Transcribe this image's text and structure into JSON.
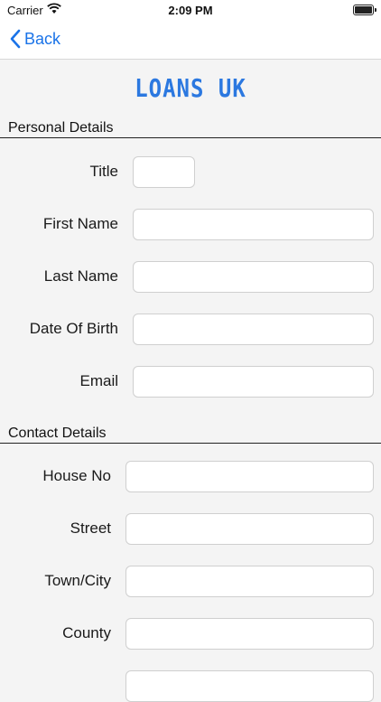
{
  "status_bar": {
    "carrier": "Carrier",
    "time": "2:09 PM"
  },
  "nav": {
    "back_label": "Back"
  },
  "app_title": "LOANS UK",
  "sections": {
    "personal": {
      "title": "Personal Details",
      "fields": {
        "title": {
          "label": "Title",
          "value": ""
        },
        "first_name": {
          "label": "First Name",
          "value": ""
        },
        "last_name": {
          "label": "Last Name",
          "value": ""
        },
        "dob": {
          "label": "Date Of Birth",
          "value": ""
        },
        "email": {
          "label": "Email",
          "value": ""
        }
      }
    },
    "contact": {
      "title": "Contact Details",
      "fields": {
        "house_no": {
          "label": "House No",
          "value": ""
        },
        "street": {
          "label": "Street",
          "value": ""
        },
        "town_city": {
          "label": "Town/City",
          "value": ""
        },
        "county": {
          "label": "County",
          "value": ""
        }
      }
    }
  }
}
